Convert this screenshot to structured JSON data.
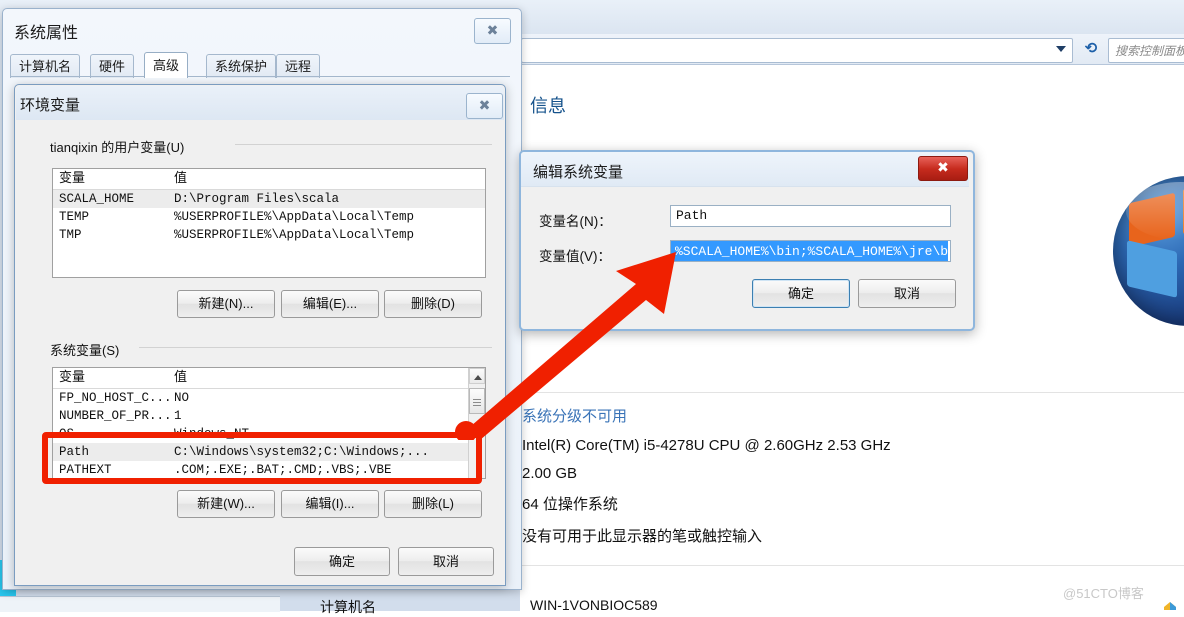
{
  "control_panel": {
    "address_placeholder": "",
    "search_placeholder": "搜索控制面板",
    "refresh_icon": "refresh-icon",
    "caret_icon": "chevron-down-icon",
    "heading": "信息",
    "system_rating": "系统分级不可用",
    "processor": "Intel(R) Core(TM) i5-4278U CPU @ 2.60GHz   2.53 GHz",
    "memory": "2.00 GB",
    "system_type": "64 位操作系统",
    "pen_touch": "没有可用于此显示器的笔或触控输入",
    "bottom_label": "计算机名",
    "bottom_value": "WIN-1VONBIOC589"
  },
  "system_properties": {
    "title": "系统属性",
    "close_icon": "close-icon",
    "close_glyph": "✖",
    "tabs": [
      {
        "label": "计算机名",
        "active": false
      },
      {
        "label": "硬件",
        "active": false
      },
      {
        "label": "高级",
        "active": true
      },
      {
        "label": "系统保护",
        "active": false
      },
      {
        "label": "远程",
        "active": false
      }
    ]
  },
  "environment_variables": {
    "title": "环境变量",
    "close_icon": "close-icon",
    "close_glyph": "✖",
    "user_group_label": "tianqixin 的用户变量(U)",
    "system_group_label": "系统变量(S)",
    "columns": {
      "name": "变量",
      "value": "值"
    },
    "user_rows": [
      {
        "name": "SCALA_HOME",
        "value": "D:\\Program Files\\scala",
        "selected": true
      },
      {
        "name": "TEMP",
        "value": "%USERPROFILE%\\AppData\\Local\\Temp",
        "selected": false
      },
      {
        "name": "TMP",
        "value": "%USERPROFILE%\\AppData\\Local\\Temp",
        "selected": false
      }
    ],
    "system_rows": [
      {
        "name": "FP_NO_HOST_C...",
        "value": "NO",
        "selected": false
      },
      {
        "name": "NUMBER_OF_PR...",
        "value": "1",
        "selected": false
      },
      {
        "name": "OS",
        "value": "Windows_NT",
        "selected": false
      },
      {
        "name": "Path",
        "value": "C:\\Windows\\system32;C:\\Windows;...",
        "selected": true
      },
      {
        "name": "PATHEXT",
        "value": ".COM;.EXE;.BAT;.CMD;.VBS;.VBE",
        "selected": false
      }
    ],
    "user_buttons": {
      "new": "新建(N)...",
      "edit": "编辑(E)...",
      "delete": "删除(D)"
    },
    "system_buttons": {
      "new": "新建(W)...",
      "edit": "编辑(I)...",
      "delete": "删除(L)"
    },
    "footer_buttons": {
      "ok": "确定",
      "cancel": "取消"
    },
    "scroll_up_icon": "scroll-up-arrow-icon"
  },
  "edit_system_variable": {
    "title": "编辑系统变量",
    "close_icon": "close-icon",
    "close_glyph": "✖",
    "name_label": "变量名(N)：",
    "name_value": "Path",
    "value_label": "变量值(V)：",
    "value_value": "%SCALA_HOME%\\bin;%SCALA_HOME%\\jre\\b",
    "ok": "确定",
    "cancel": "取消"
  },
  "annotations": {
    "highlight_color": "#f02000",
    "arrow_icon": "red-arrow-icon",
    "highlight_box_icon": "red-highlight-box-icon"
  },
  "watermark": {
    "text": "@51CTO博客"
  }
}
